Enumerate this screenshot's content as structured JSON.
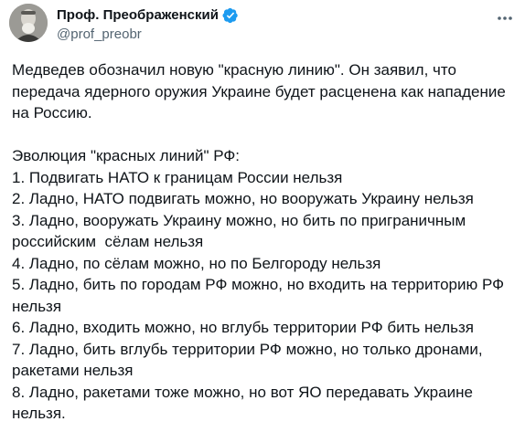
{
  "author": {
    "display_name": "Проф. Преображенский",
    "handle": "@prof_preobr",
    "verified_icon": "verified-badge-icon",
    "verified_color": "#1d9bf0"
  },
  "menu_icon": "more-horizontal-icon",
  "tweet": {
    "intro": "Медведев обозначил новую \"красную линию\". Он заявил, что передача ядерного оружия Украине будет расценена как нападение на Россию.",
    "list_title": "Эволюция \"красных линий\" РФ:",
    "items": [
      "1. Подвигать НАТО к границам России нельзя",
      "2. Ладно, НАТО подвигать можно, но вооружать Украину нельзя",
      "3. Ладно, вооружать Украину можно, но бить по приграничным российским  сёлам нельзя",
      "4. Ладно, по сёлам можно, но по Белгороду нельзя",
      "5. Ладно, бить по городам РФ можно, но входить на территорию РФ нельзя",
      "6. Ладно, входить можно, но вглубь территории РФ бить нельзя",
      "7. Ладно, бить вглубь территории РФ можно, но только дронами, ракетами нельзя",
      "8. Ладно, ракетами тоже можно, но вот ЯО передавать Украине нельзя."
    ]
  }
}
